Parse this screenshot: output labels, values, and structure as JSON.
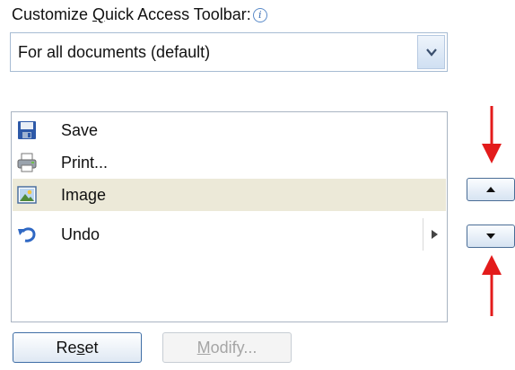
{
  "heading": {
    "before": "Customize ",
    "accel": "Q",
    "after": "uick Access Toolbar:",
    "info_icon": "info-icon"
  },
  "scope_select": {
    "value": "For all documents (default)",
    "icon": "chevron-down-icon"
  },
  "toolbar_items": [
    {
      "label": "Save",
      "icon": "save-icon"
    },
    {
      "label": "Print...",
      "icon": "print-icon"
    },
    {
      "label": "Image",
      "icon": "image-icon",
      "selected": true
    },
    {
      "label": "Undo",
      "icon": "undo-icon",
      "has_submenu": true
    }
  ],
  "buttons": {
    "reset_a": "Re",
    "reset_accel": "s",
    "reset_b": "et",
    "modify_accel": "M",
    "modify_rest": "odify..."
  },
  "colors": {
    "annotation_arrow": "#e31b1b",
    "selected_row": "#ece9d8",
    "focus_border": "#3f6ea6"
  }
}
